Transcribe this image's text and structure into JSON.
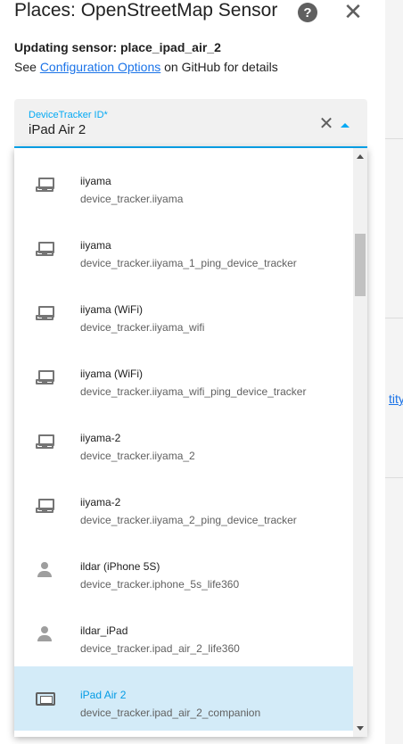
{
  "dialog": {
    "title": "Places: OpenStreetMap Sensor",
    "help_icon": "help-circle-icon",
    "close_icon": "close-icon",
    "updating_label": "Updating sensor: place_ipad_air_2",
    "see_prefix": "See ",
    "config_link": "Configuration Options",
    "see_suffix": " on GitHub for details"
  },
  "field": {
    "label": "DeviceTracker ID*",
    "value": "iPad Air 2",
    "clear_icon": "close-icon",
    "caret_icon": "menu-up-icon",
    "accent_color": "#03a9f4"
  },
  "dropdown": {
    "items": [
      {
        "name": "iiyama",
        "entity": "device_tracker.iiyama",
        "icon": "laptop-icon"
      },
      {
        "name": "iiyama",
        "entity": "device_tracker.iiyama_1_ping_device_tracker",
        "icon": "laptop-icon"
      },
      {
        "name": "iiyama (WiFi)",
        "entity": "device_tracker.iiyama_wifi",
        "icon": "laptop-icon"
      },
      {
        "name": "iiyama (WiFi)",
        "entity": "device_tracker.iiyama_wifi_ping_device_tracker",
        "icon": "laptop-icon"
      },
      {
        "name": "iiyama-2",
        "entity": "device_tracker.iiyama_2",
        "icon": "laptop-icon"
      },
      {
        "name": "iiyama-2",
        "entity": "device_tracker.iiyama_2_ping_device_tracker",
        "icon": "laptop-icon"
      },
      {
        "name": "ildar (iPhone 5S)",
        "entity": "device_tracker.iphone_5s_life360",
        "icon": "account-icon"
      },
      {
        "name": "ildar_iPad",
        "entity": "device_tracker.ipad_air_2_life360",
        "icon": "account-icon"
      },
      {
        "name": "iPad Air 2",
        "entity": "device_tracker.ipad_air_2_companion",
        "icon": "tablet-icon",
        "selected": true
      }
    ],
    "selected_bg": "#d3ebf8"
  },
  "background": {
    "link_fragment": "tity"
  }
}
